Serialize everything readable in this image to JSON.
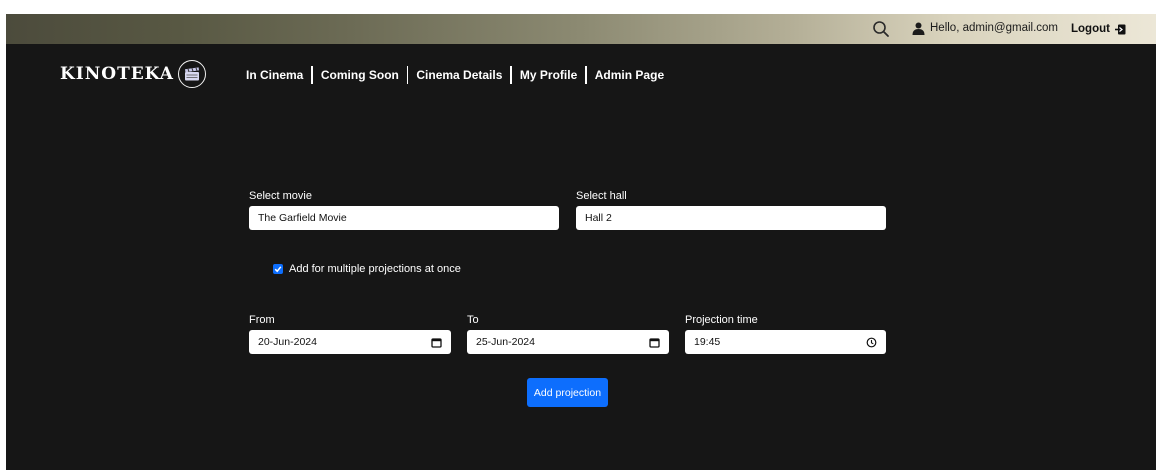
{
  "header": {
    "greeting": "Hello, admin@gmail.com",
    "logout_label": "Logout",
    "icons": [
      "search-icon",
      "user-icon",
      "logout-icon"
    ]
  },
  "logo": {
    "text": "KINOTEKA",
    "icon": "clapperboard-icon"
  },
  "nav": {
    "items": [
      {
        "label": "In Cinema"
      },
      {
        "label": "Coming Soon"
      },
      {
        "label": "Cinema Details"
      },
      {
        "label": "My Profile"
      },
      {
        "label": "Admin Page"
      }
    ]
  },
  "form": {
    "movie": {
      "label": "Select movie",
      "value": "The Garfield Movie"
    },
    "hall": {
      "label": "Select hall",
      "value": "Hall 2"
    },
    "multiple": {
      "label": "Add for multiple projections at once",
      "checked": true
    },
    "from": {
      "label": "From",
      "value": "20-Jun-2024"
    },
    "to": {
      "label": "To",
      "value": "25-Jun-2024"
    },
    "time": {
      "label": "Projection time",
      "value": "19:45"
    },
    "submit_label": "Add projection"
  },
  "colors": {
    "background": "#161616",
    "accent": "#0d6efd",
    "field_background": "#ffffff"
  }
}
